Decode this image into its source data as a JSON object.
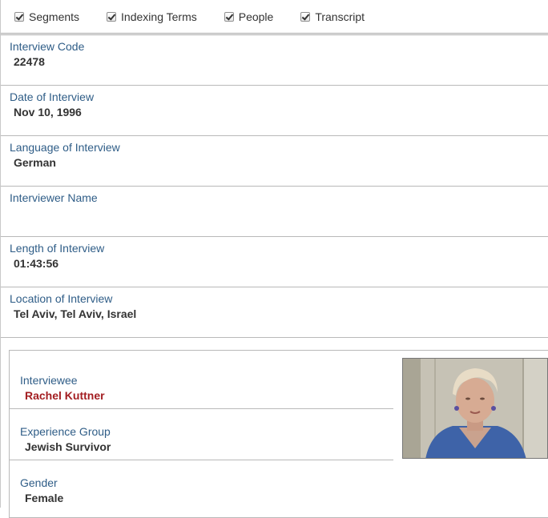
{
  "filters": [
    {
      "label": "Segments",
      "checked": true
    },
    {
      "label": "Indexing Terms",
      "checked": true
    },
    {
      "label": "People",
      "checked": true
    },
    {
      "label": "Transcript",
      "checked": true
    }
  ],
  "interview": [
    {
      "label": "Interview Code",
      "value": "22478"
    },
    {
      "label": "Date of Interview",
      "value": "Nov 10, 1996"
    },
    {
      "label": "Language of Interview",
      "value": "German"
    },
    {
      "label": "Interviewer Name",
      "value": ""
    },
    {
      "label": "Length of Interview",
      "value": "01:43:56"
    },
    {
      "label": "Location of Interview",
      "value": "Tel Aviv, Tel Aviv, Israel"
    }
  ],
  "person": {
    "interviewee_label": "Interviewee",
    "interviewee_value": "Rachel Kuttner",
    "experience_label": "Experience Group",
    "experience_value": "Jewish Survivor",
    "gender_label": "Gender",
    "gender_value": "Female"
  },
  "colors": {
    "label": "#2f5d87",
    "value": "#333333",
    "interviewee_name": "#a31e22"
  }
}
